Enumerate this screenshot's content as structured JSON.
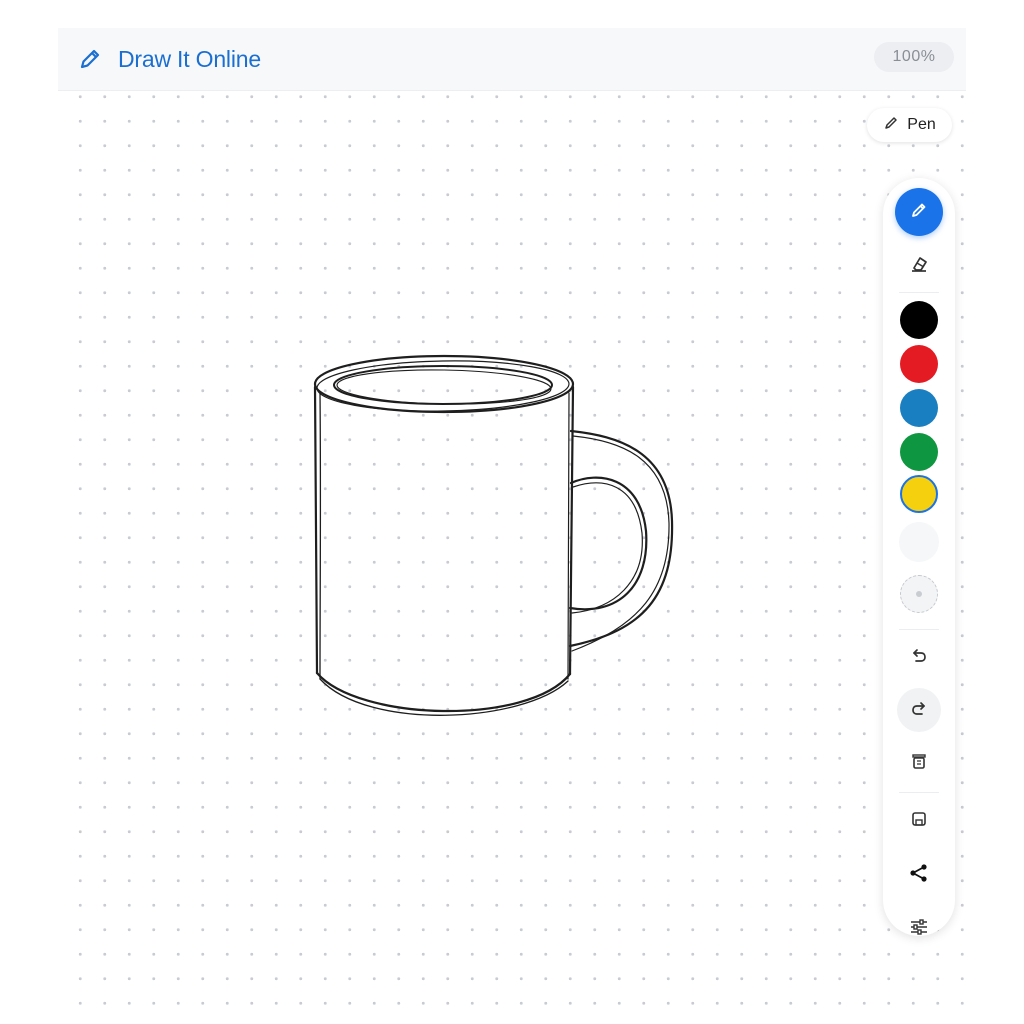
{
  "header": {
    "title": "Draw It Online",
    "zoom": "100%"
  },
  "active_tool": {
    "label": "Pen"
  },
  "toolbar": {
    "tools": [
      {
        "icon": "pencil-icon",
        "active": true,
        "accent": "#1a73e8"
      },
      {
        "icon": "eraser-icon",
        "active": false
      }
    ],
    "colors": [
      {
        "name": "black",
        "hex": "#000000"
      },
      {
        "name": "red",
        "hex": "#e41b23"
      },
      {
        "name": "blue",
        "hex": "#1a7fc1"
      },
      {
        "name": "green",
        "hex": "#0f9640"
      },
      {
        "name": "yellow",
        "hex": "#f5d00f",
        "selected": true
      }
    ],
    "actions": [
      "undo-icon",
      "redo-icon",
      "clear-icon",
      "save-icon",
      "share-icon",
      "settings-icon"
    ]
  },
  "canvas": {
    "drawing": "coffee mug sketch"
  }
}
